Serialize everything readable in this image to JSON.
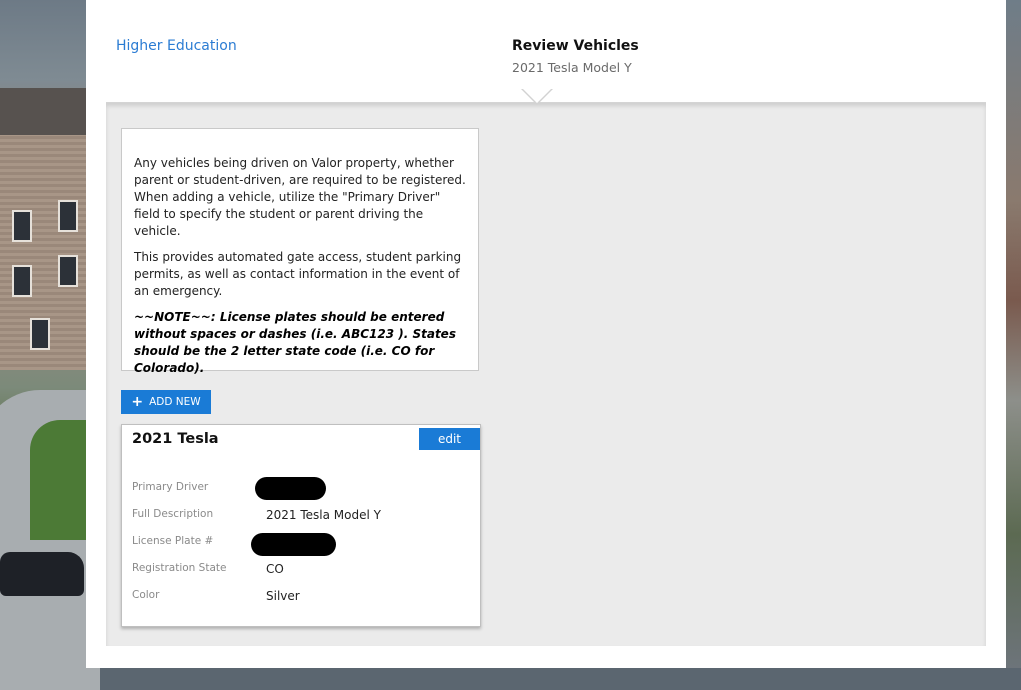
{
  "header": {
    "back_link": "Higher Education",
    "title": "Review Vehicles",
    "subtitle": "2021 Tesla Model Y"
  },
  "info": {
    "paragraph1": "Any vehicles being driven on Valor property, whether parent or student-driven, are required to be registered. When adding a vehicle, utilize the \"Primary Driver\" field to specify the student or parent driving the vehicle.",
    "paragraph2": "This provides automated gate access, student parking permits, as well as contact information in the event of an emergency.",
    "note": "~~NOTE~~: License plates should be entered without spaces or dashes (i.e. ABC123 ). States should be the 2 letter state code (i.e. CO for Colorado)."
  },
  "actions": {
    "add_new_label": "ADD NEW",
    "add_new_icon": "plus-icon"
  },
  "vehicle": {
    "title": "2021 Tesla",
    "edit_label": "edit",
    "fields": {
      "primary_driver_label": "Primary Driver",
      "primary_driver_value": "",
      "full_description_label": "Full Description",
      "full_description_value": "2021 Tesla Model Y",
      "license_plate_label": "License Plate #",
      "license_plate_value": "",
      "registration_state_label": "Registration State",
      "registration_state_value": "CO",
      "color_label": "Color",
      "color_value": "Silver"
    }
  },
  "colors": {
    "accent": "#1a7bd6",
    "link": "#2b7cd3",
    "panel_bg": "#ebebeb"
  }
}
